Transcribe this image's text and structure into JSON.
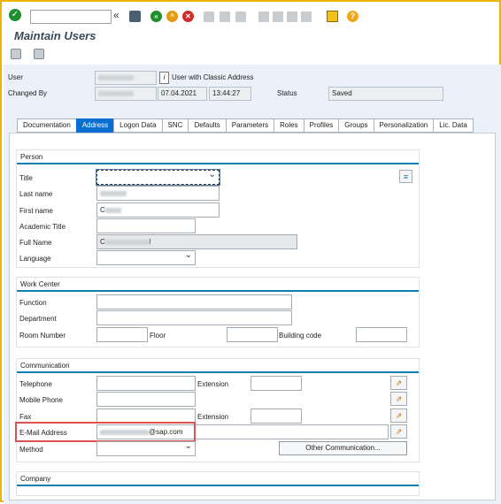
{
  "window": {
    "title": "Maintain Users"
  },
  "toolbar": {
    "command_placeholder": "",
    "nav_back": "«"
  },
  "header": {
    "user_label": "User",
    "user_type_text": "User with Classic Address",
    "changed_by_label": "Changed By",
    "changed_date": "07.04.2021",
    "changed_time": "13:44:27",
    "status_label": "Status",
    "status_value": "Saved"
  },
  "tabs": [
    {
      "label": "Documentation"
    },
    {
      "label": "Address"
    },
    {
      "label": "Logon Data"
    },
    {
      "label": "SNC"
    },
    {
      "label": "Defaults"
    },
    {
      "label": "Parameters"
    },
    {
      "label": "Roles"
    },
    {
      "label": "Profiles"
    },
    {
      "label": "Groups"
    },
    {
      "label": "Personalization"
    },
    {
      "label": "Lic. Data"
    }
  ],
  "person": {
    "title": "Person",
    "title_label": "Title",
    "last_name_label": "Last name",
    "first_name_label": "First name",
    "first_name_value": "C",
    "academic_title_label": "Academic Title",
    "full_name_label": "Full Name",
    "full_name_value": "C",
    "full_name_suffix": "l",
    "language_label": "Language"
  },
  "work_center": {
    "title": "Work Center",
    "function_label": "Function",
    "department_label": "Department",
    "room_label": "Room Number",
    "floor_label": "Floor",
    "building_label": "Building code"
  },
  "communication": {
    "title": "Communication",
    "telephone_label": "Telephone",
    "extension_label": "Extension",
    "mobile_label": "Mobile Phone",
    "fax_label": "Fax",
    "fax_extension_label": "Extension",
    "email_label": "E-Mail Address",
    "email_value": "@sap.com",
    "method_label": "Method",
    "other_comm_button": "Other Communication..."
  },
  "company": {
    "title": "Company"
  },
  "colors": {
    "accent": "#0a6ed1",
    "highlight": "#d9534f",
    "frame": "#f0b400"
  }
}
